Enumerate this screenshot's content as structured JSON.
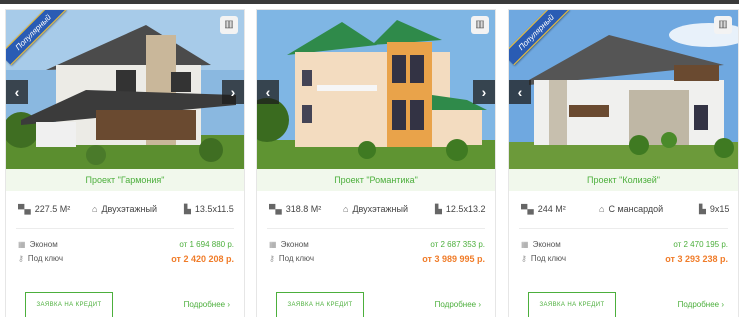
{
  "ribbon_text": "Популярный",
  "cards": [
    {
      "badge": "Популярный",
      "name": "Проект \"Гармония\"",
      "area": "227.5 М²",
      "floors": "Двухэтажный",
      "size": "13.5x11.5",
      "econom_label": "Эконом",
      "econom_price": "от 1 694 880 р.",
      "turnkey_label": "Под ключ",
      "turnkey_price": "от 2 420 208 р.",
      "credit_label": "ЗАЯВКА НА КРЕДИТ",
      "more_label": "Подробнее ›"
    },
    {
      "name": "Проект \"Романтика\"",
      "area": "318.8 М²",
      "floors": "Двухэтажный",
      "size": "12.5x13.2",
      "econom_label": "Эконом",
      "econom_price": "от 2 687 353 р.",
      "turnkey_label": "Под ключ",
      "turnkey_price": "от 3 989 995 р.",
      "credit_label": "ЗАЯВКА НА КРЕДИТ",
      "more_label": "Подробнее ›"
    },
    {
      "badge": "Популярный",
      "name": "Проект \"Колизей\"",
      "area": "244 М²",
      "floors": "С мансардой",
      "size": "9x15",
      "econom_label": "Эконом",
      "econom_price": "от 2 470 195 р.",
      "turnkey_label": "Под ключ",
      "turnkey_price": "от 3 293 238 р.",
      "credit_label": "ЗАЯВКА НА КРЕДИТ",
      "more_label": "Подробнее ›"
    }
  ],
  "icons": {
    "chart": "bar-chart-icon",
    "prev": "chevron-left-icon",
    "next": "chevron-right-icon",
    "area": "bed-area-icon",
    "floors": "house-icon",
    "size": "ruler-icon",
    "econom": "grid-icon",
    "turnkey": "key-icon"
  },
  "colors": {
    "accent_green": "#4caf3c",
    "price_orange": "#f07c29",
    "ribbon_blue": "#2a5cb4"
  }
}
